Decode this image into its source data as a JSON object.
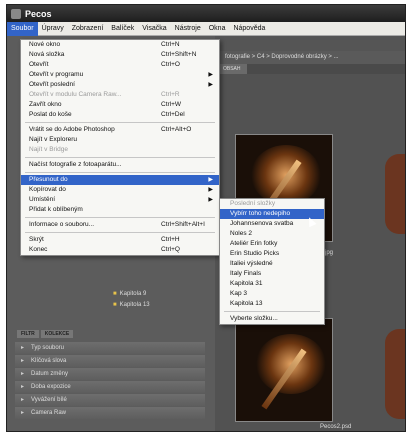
{
  "app": {
    "title": "Pecos"
  },
  "menubar": [
    "Soubor",
    "Úpravy",
    "Zobrazení",
    "Balíček",
    "Visačka",
    "Nástroje",
    "Okna",
    "Nápověda"
  ],
  "pathbar": "fotografie > C4 > Doprovodné obrázky > ...",
  "content_tabs": [
    "OBSAH"
  ],
  "file_menu": [
    {
      "label": "Nové okno",
      "shortcut": "Ctrl+N"
    },
    {
      "label": "Nová složka",
      "shortcut": "Ctrl+Shift+N"
    },
    {
      "label": "Otevřít",
      "shortcut": "Ctrl+O"
    },
    {
      "label": "Otevřít v programu",
      "submenu": true
    },
    {
      "label": "Otevřít poslední",
      "submenu": true
    },
    {
      "label": "Otevřít v modulu Camera Raw...",
      "shortcut": "Ctrl+R",
      "disabled": true
    },
    {
      "label": "Zavřít okno",
      "shortcut": "Ctrl+W"
    },
    {
      "label": "Poslat do koše",
      "shortcut": "Ctrl+Del"
    },
    {
      "sep": true
    },
    {
      "label": "Vrátit se do Adobe Photoshop",
      "shortcut": "Ctrl+Alt+O"
    },
    {
      "label": "Najít v Exploreru"
    },
    {
      "label": "Najít v Bridge",
      "disabled": true
    },
    {
      "sep": true
    },
    {
      "label": "Načíst fotografie z fotoaparátu..."
    },
    {
      "sep": true
    },
    {
      "label": "Přesunout do",
      "submenu": true,
      "highlight": true
    },
    {
      "label": "Kopírovat do",
      "submenu": true
    },
    {
      "label": "Umístění",
      "submenu": true
    },
    {
      "label": "Přidat k oblíbeným"
    },
    {
      "sep": true
    },
    {
      "label": "Informace o souboru...",
      "shortcut": "Ctrl+Shift+Alt+I"
    },
    {
      "sep": true
    },
    {
      "label": "Skrýt",
      "shortcut": "Ctrl+H"
    },
    {
      "label": "Konec",
      "shortcut": "Ctrl+Q"
    }
  ],
  "move_submenu": [
    {
      "label": "Poslední složky",
      "disabled": true
    },
    {
      "label": "Vybírr toho nedepiho",
      "highlight": true
    },
    {
      "label": "Johannsenova svatba"
    },
    {
      "label": "Noles 2"
    },
    {
      "label": "Ateliér Erin fotky"
    },
    {
      "label": "Erin Studio Picks"
    },
    {
      "label": "Italiei výsledné"
    },
    {
      "label": "Italy Finals"
    },
    {
      "label": "Kapitola 31"
    },
    {
      "label": "Kap 3"
    },
    {
      "label": "Kapitola 13"
    },
    {
      "sep": true
    },
    {
      "label": "Vyberte složku..."
    }
  ],
  "folders": [
    "Kapitola 9",
    "Kapitola 13"
  ],
  "filter_tabs": [
    "FILTR",
    "KOLEKCE"
  ],
  "filter_rows": [
    "Typ souboru",
    "Klíčová slova",
    "Datum změny",
    "Doba expozice",
    "Vyvážení bílé",
    "Camera Raw"
  ],
  "captions": {
    "thumb1": "jpg",
    "thumb2": "Pecos2.psd"
  }
}
